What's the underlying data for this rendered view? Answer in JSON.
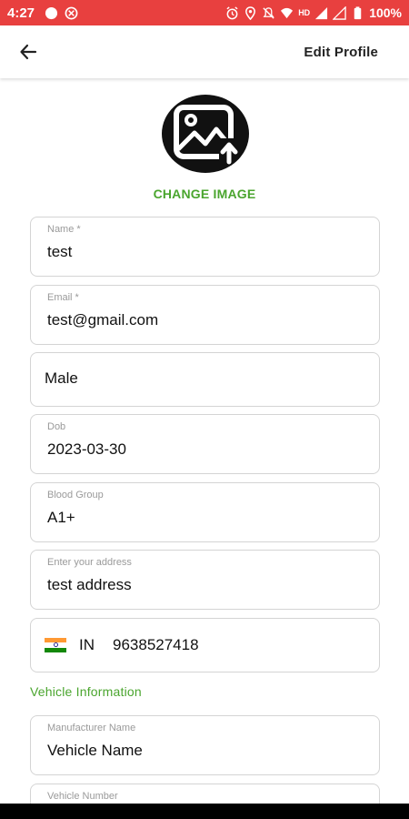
{
  "status_bar": {
    "time": "4:27",
    "battery": "100%",
    "network": "HD"
  },
  "header": {
    "title": "Edit Profile"
  },
  "profile": {
    "change_image_label": "CHANGE IMAGE"
  },
  "fields": {
    "name": {
      "label": "Name *",
      "value": "test"
    },
    "email": {
      "label": "Email *",
      "value": "test@gmail.com"
    },
    "gender": {
      "value": "Male"
    },
    "dob": {
      "label": "Dob",
      "value": "2023-03-30"
    },
    "blood_group": {
      "label": "Blood Group",
      "value": "A1+"
    },
    "address": {
      "label": "Enter your address",
      "value": "test address"
    },
    "phone": {
      "country_code": "IN",
      "number": "9638527418"
    }
  },
  "vehicle": {
    "section_title": "Vehicle Information",
    "manufacturer": {
      "label": "Manufacturer Name",
      "value": "Vehicle Name"
    },
    "number": {
      "label": "Vehicle Number"
    }
  },
  "colors": {
    "status_bar": "#e8403f",
    "accent": "#4aa52e",
    "border": "#d4d4d4"
  }
}
